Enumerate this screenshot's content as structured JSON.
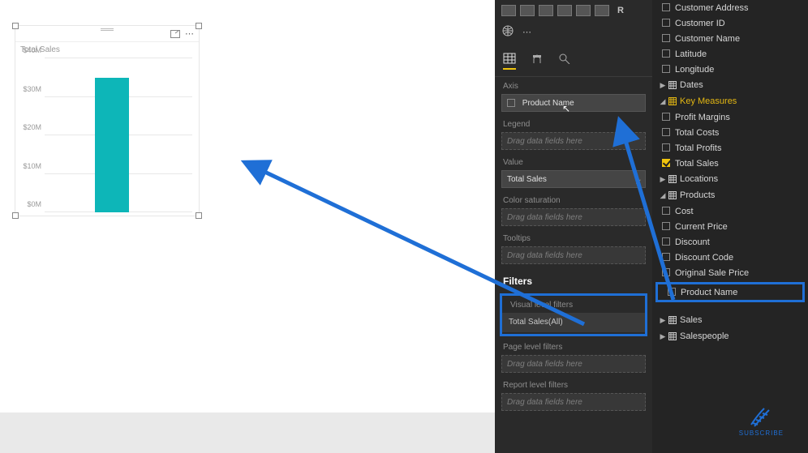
{
  "chart": {
    "title": "Total Sales",
    "focus_icon": "focus-mode-icon",
    "more_icon": "more-options-icon"
  },
  "chart_data": {
    "type": "bar",
    "categories": [
      ""
    ],
    "values": [
      35000000
    ],
    "title": "Total Sales",
    "xlabel": "",
    "ylabel": "",
    "ylim": [
      0,
      40000000
    ],
    "y_ticks": [
      "$0M",
      "$10M",
      "$20M",
      "$30M",
      "$40M"
    ]
  },
  "viz": {
    "r_label": "R",
    "axis_label": "Axis",
    "axis_field": "Product Name",
    "legend_label": "Legend",
    "legend_placeholder": "Drag data fields here",
    "value_label": "Value",
    "value_field": "Total Sales",
    "color_sat_label": "Color saturation",
    "color_sat_placeholder": "Drag data fields here",
    "tooltips_label": "Tooltips",
    "tooltips_placeholder": "Drag data fields here",
    "filters_header": "Filters",
    "visual_filters_label": "Visual level filters",
    "visual_filter_item": "Total Sales(All)",
    "page_filters_label": "Page level filters",
    "page_filters_placeholder": "Drag data fields here",
    "report_filters_label": "Report level filters",
    "report_filters_placeholder": "Drag data fields here"
  },
  "fields": {
    "customers_children": [
      {
        "label": "Customer Address"
      },
      {
        "label": "Customer ID"
      },
      {
        "label": "Customer Name"
      },
      {
        "label": "Latitude"
      },
      {
        "label": "Longitude"
      }
    ],
    "dates_label": "Dates",
    "key_measures_label": "Key Measures",
    "key_measures_children": [
      {
        "label": "Profit Margins",
        "on": false
      },
      {
        "label": "Total Costs",
        "on": false
      },
      {
        "label": "Total Profits",
        "on": false
      },
      {
        "label": "Total Sales",
        "on": true
      }
    ],
    "locations_label": "Locations",
    "products_label": "Products",
    "products_children": [
      {
        "label": "Cost"
      },
      {
        "label": "Current Price"
      },
      {
        "label": "Discount"
      },
      {
        "label": "Discount Code"
      },
      {
        "label": "Original Sale Price"
      }
    ],
    "product_name_label": "Product Name",
    "sales_label": "Sales",
    "salespeople_label": "Salespeople",
    "subscribe_label": "SUBSCRIBE"
  }
}
